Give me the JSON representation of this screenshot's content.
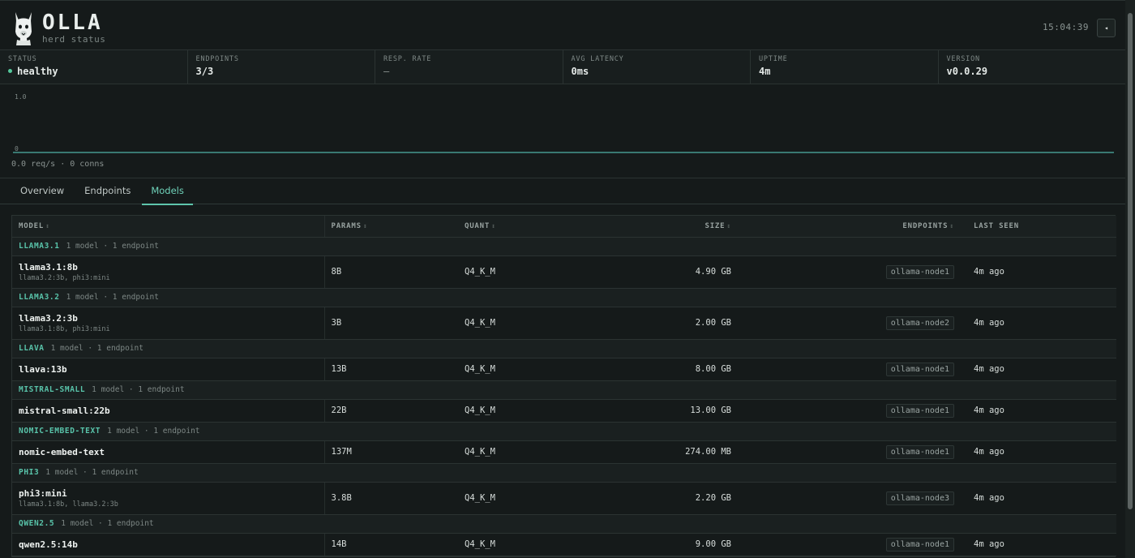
{
  "app": {
    "title": "OLLA",
    "subtitle": "herd status",
    "clock": "15:04:39",
    "collapse_icon": "◂"
  },
  "stats": [
    {
      "label": "STATUS",
      "value": "healthy",
      "indicator": "status-dot",
      "indicator_color": "#54c99c"
    },
    {
      "label": "ENDPOINTS",
      "value": "3/3"
    },
    {
      "label": "RESP. RATE",
      "value": "—"
    },
    {
      "label": "AVG LATENCY",
      "value": "0ms"
    },
    {
      "label": "UPTIME",
      "value": "4m"
    },
    {
      "label": "VERSION",
      "value": "v0.0.29"
    }
  ],
  "chart": {
    "ytick_top": "1.0",
    "ytick_bottom": "0",
    "caption": "0.0 req/s · 0 conns"
  },
  "chart_data": {
    "type": "line",
    "title": "",
    "xlabel": "",
    "ylabel": "",
    "ylim": [
      0,
      1.0
    ],
    "series": [
      {
        "values": [
          0,
          0
        ]
      }
    ],
    "grid": false,
    "line_color": "#4fb2a6"
  },
  "tabs": [
    {
      "label": "Overview",
      "active": false
    },
    {
      "label": "Endpoints",
      "active": false
    },
    {
      "label": "Models",
      "active": true
    }
  ],
  "table": {
    "columns": {
      "model": "MODEL",
      "params": "PARAMS",
      "quant": "QUANT",
      "size": "SIZE",
      "endpoints": "ENDPOINTS",
      "last_seen": "LAST SEEN"
    },
    "sort_icon": "↕",
    "groups": [
      {
        "name": "LLAMA3.1",
        "meta": "1 model · 1 endpoint",
        "models": [
          {
            "name": "llama3.1:8b",
            "aliases": "llama3.2:3b, phi3:mini",
            "params": "8B",
            "quant": "Q4_K_M",
            "size": "4.90 GB",
            "endpoint": "ollama-node1",
            "last_seen": "4m ago"
          }
        ]
      },
      {
        "name": "LLAMA3.2",
        "meta": "1 model · 1 endpoint",
        "models": [
          {
            "name": "llama3.2:3b",
            "aliases": "llama3.1:8b, phi3:mini",
            "params": "3B",
            "quant": "Q4_K_M",
            "size": "2.00 GB",
            "endpoint": "ollama-node2",
            "last_seen": "4m ago"
          }
        ]
      },
      {
        "name": "LLAVA",
        "meta": "1 model · 1 endpoint",
        "models": [
          {
            "name": "llava:13b",
            "aliases": "",
            "params": "13B",
            "quant": "Q4_K_M",
            "size": "8.00 GB",
            "endpoint": "ollama-node1",
            "last_seen": "4m ago"
          }
        ]
      },
      {
        "name": "MISTRAL-SMALL",
        "meta": "1 model · 1 endpoint",
        "models": [
          {
            "name": "mistral-small:22b",
            "aliases": "",
            "params": "22B",
            "quant": "Q4_K_M",
            "size": "13.00 GB",
            "endpoint": "ollama-node1",
            "last_seen": "4m ago"
          }
        ]
      },
      {
        "name": "NOMIC-EMBED-TEXT",
        "meta": "1 model · 1 endpoint",
        "models": [
          {
            "name": "nomic-embed-text",
            "aliases": "",
            "params": "137M",
            "quant": "Q4_K_M",
            "size": "274.00 MB",
            "endpoint": "ollama-node1",
            "last_seen": "4m ago"
          }
        ]
      },
      {
        "name": "PHI3",
        "meta": "1 model · 1 endpoint",
        "models": [
          {
            "name": "phi3:mini",
            "aliases": "llama3.1:8b, llama3.2:3b",
            "params": "3.8B",
            "quant": "Q4_K_M",
            "size": "2.20 GB",
            "endpoint": "ollama-node3",
            "last_seen": "4m ago"
          }
        ]
      },
      {
        "name": "QWEN2.5",
        "meta": "1 model · 1 endpoint",
        "models": [
          {
            "name": "qwen2.5:14b",
            "aliases": "",
            "params": "14B",
            "quant": "Q4_K_M",
            "size": "9.00 GB",
            "endpoint": "ollama-node1",
            "last_seen": "4m ago"
          }
        ]
      }
    ]
  },
  "colors": {
    "accent": "#5ec5ab",
    "background": "#151a1a",
    "healthy": "#54c99c"
  }
}
